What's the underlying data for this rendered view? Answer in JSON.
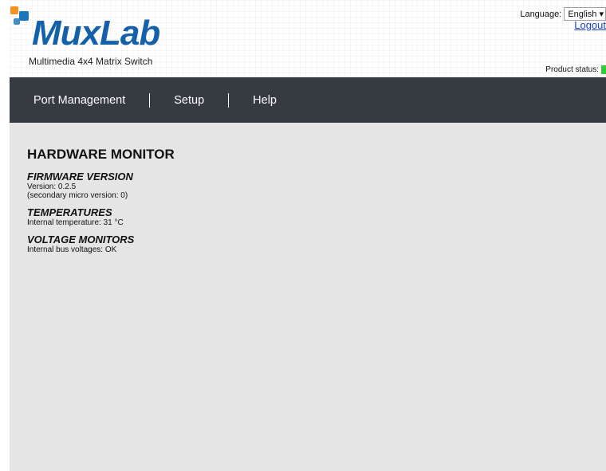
{
  "header": {
    "logo_text": "MuxLab",
    "tagline": "Multimedia 4x4 Matrix Switch",
    "language_label": "Language:",
    "language_value": "English",
    "logout_label": "Logout",
    "product_status_label": "Product status:",
    "status_color": "#33cc33"
  },
  "nav": {
    "items": [
      {
        "label": "Port Management"
      },
      {
        "label": "Setup"
      },
      {
        "label": "Help"
      }
    ]
  },
  "main": {
    "title": "HARDWARE MONITOR",
    "sections": [
      {
        "title": "FIRMWARE VERSION",
        "lines": [
          "Version: 0.2.5",
          "(secondary micro version: 0)"
        ]
      },
      {
        "title": "TEMPERATURES",
        "lines": [
          "Internal temperature: 31 °C"
        ]
      },
      {
        "title": "VOLTAGE MONITORS",
        "lines": [
          "Internal bus voltages: OK"
        ]
      }
    ]
  },
  "colors": {
    "brand_blue": "#1561a9",
    "brand_orange": "#f6911e",
    "nav_bg": "#363b42",
    "content_bg": "#e5e5e5"
  }
}
